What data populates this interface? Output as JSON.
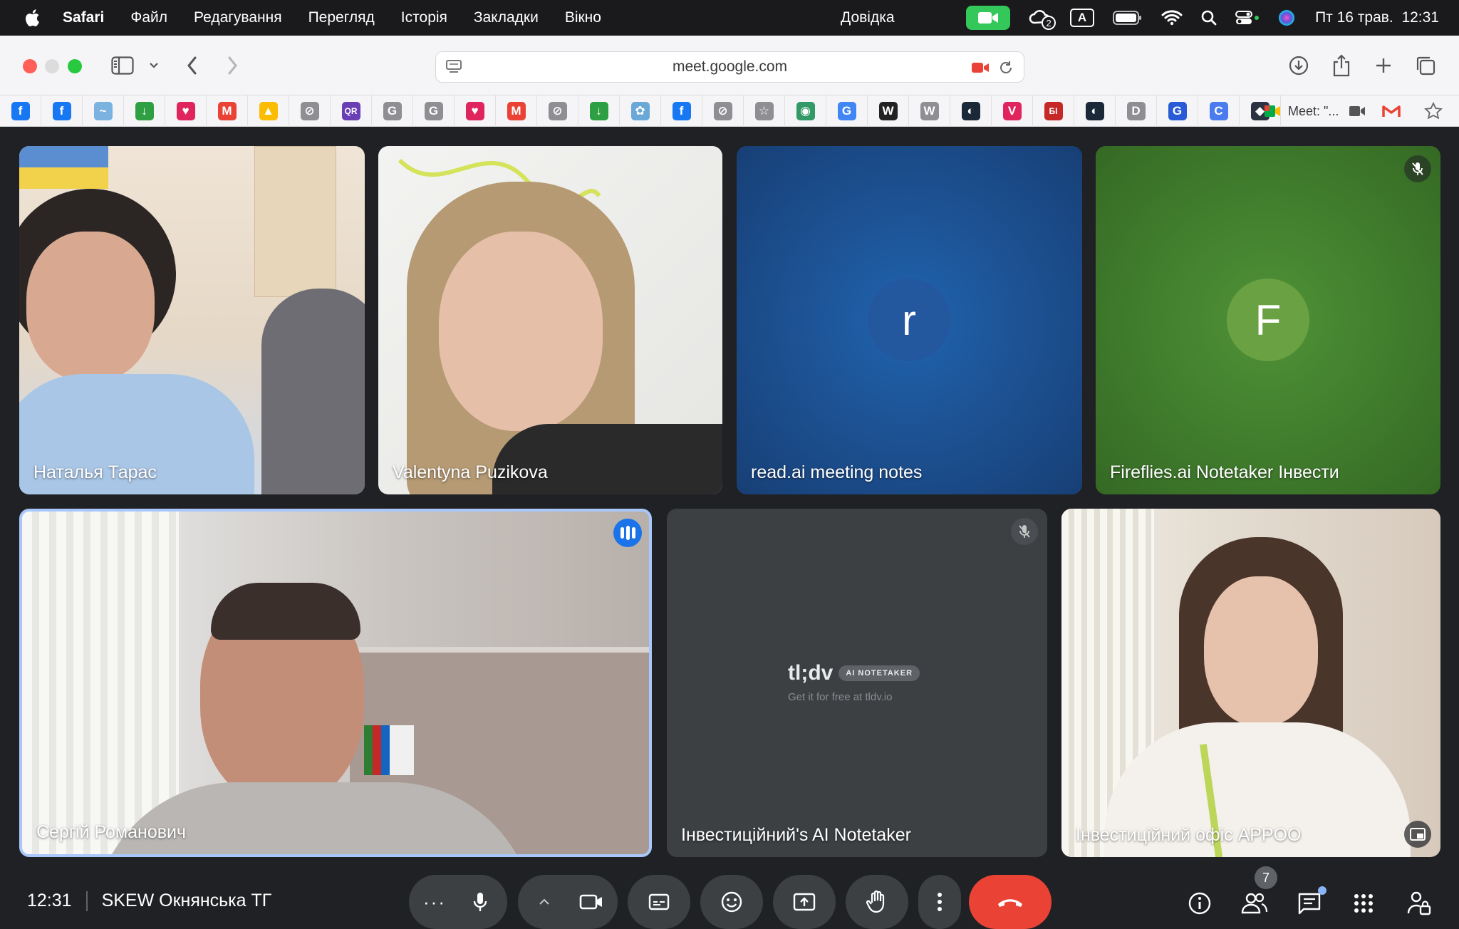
{
  "menubar": {
    "app": "Safari",
    "items": [
      "Файл",
      "Редагування",
      "Перегляд",
      "Історія",
      "Закладки",
      "Вікно"
    ],
    "help": "Довідка",
    "badge_count": "2",
    "input_source": "A",
    "datetime": "Пт 16 трав.  12:31"
  },
  "browser": {
    "url": "meet.google.com",
    "active_tab": "Meet: \"..."
  },
  "bookmarks": [
    {
      "icon": "facebook-icon",
      "color": "#1877f2",
      "glyph": "f"
    },
    {
      "icon": "facebook-icon",
      "color": "#1877f2",
      "glyph": "f"
    },
    {
      "icon": "site-icon",
      "color": "#7bb3e0",
      "glyph": "~"
    },
    {
      "icon": "download-arrow-icon",
      "color": "#2ea043",
      "glyph": "↓"
    },
    {
      "icon": "heart-icon",
      "color": "#e0245e",
      "glyph": "♥"
    },
    {
      "icon": "gmail-icon",
      "color": "#ea4335",
      "glyph": "M"
    },
    {
      "icon": "drive-icon",
      "color": "#fbbc04",
      "glyph": "▲"
    },
    {
      "icon": "compass-icon",
      "color": "#8e8e93",
      "glyph": "⊘"
    },
    {
      "icon": "qr-code-icon",
      "color": "#6a3fb5",
      "glyph": "QR"
    },
    {
      "icon": "g-letter-icon",
      "color": "#8e8e93",
      "glyph": "G"
    },
    {
      "icon": "g-letter-icon",
      "color": "#8e8e93",
      "glyph": "G"
    },
    {
      "icon": "heart-icon",
      "color": "#e0245e",
      "glyph": "♥"
    },
    {
      "icon": "gmail-icon",
      "color": "#ea4335",
      "glyph": "M"
    },
    {
      "icon": "compass-icon",
      "color": "#8e8e93",
      "glyph": "⊘"
    },
    {
      "icon": "download-arrow-icon",
      "color": "#2ea043",
      "glyph": "↓"
    },
    {
      "icon": "site-icon",
      "color": "#6aa8d8",
      "glyph": "✿"
    },
    {
      "icon": "facebook-icon",
      "color": "#1877f2",
      "glyph": "f"
    },
    {
      "icon": "compass-icon",
      "color": "#8e8e93",
      "glyph": "⊘"
    },
    {
      "icon": "star-icon",
      "color": "#8e8e93",
      "glyph": "☆"
    },
    {
      "icon": "wikimedia-icon",
      "color": "#339966",
      "glyph": "◉"
    },
    {
      "icon": "google-icon",
      "color": "#4285f4",
      "glyph": "G"
    },
    {
      "icon": "wikipedia-icon",
      "color": "#222222",
      "glyph": "W"
    },
    {
      "icon": "w-letter-icon",
      "color": "#8e8e93",
      "glyph": "W"
    },
    {
      "icon": "steam-icon",
      "color": "#1b2838",
      "glyph": "◐"
    },
    {
      "icon": "shield-v-icon",
      "color": "#e0245e",
      "glyph": "V"
    },
    {
      "icon": "bi-letters-icon",
      "color": "#c62828",
      "glyph": "БІ"
    },
    {
      "icon": "steam-icon",
      "color": "#1b2838",
      "glyph": "◐"
    },
    {
      "icon": "d-letter-icon",
      "color": "#8e8e93",
      "glyph": "D"
    },
    {
      "icon": "grammarly-icon",
      "color": "#2a5bd7",
      "glyph": "G"
    },
    {
      "icon": "c-letter-icon",
      "color": "#4a7cf0",
      "glyph": "C"
    },
    {
      "icon": "cursor-icon",
      "color": "#2b3440",
      "glyph": "◆"
    }
  ],
  "participants": [
    {
      "name": "Наталья Тарас"
    },
    {
      "name": "Valentyna Puzikova"
    },
    {
      "name": "read.ai meeting notes",
      "initial": "r"
    },
    {
      "name": "Fireflies.ai Notetaker Інвести",
      "initial": "F"
    },
    {
      "name": "Сергій Романович"
    },
    {
      "name": "Інвестиційний's AI Notetaker",
      "logo": "tl;dv",
      "logo_tag": "AI NOTETAKER",
      "logo_sub": "Get it for free at tldv.io"
    },
    {
      "name": "Інвестиційний офіс APPOO"
    }
  ],
  "meeting": {
    "time": "12:31",
    "title": "SKEW Окнянська ТГ",
    "people_count": "7"
  },
  "colors": {
    "meet_bg": "#202124",
    "button_gray": "#3c4043",
    "end_red": "#ea4335",
    "read_tile": "#1c4f8f",
    "read_avatar": "#23579e",
    "fireflies_tile": "#3f7a2c",
    "fireflies_avatar": "#6aa243"
  }
}
